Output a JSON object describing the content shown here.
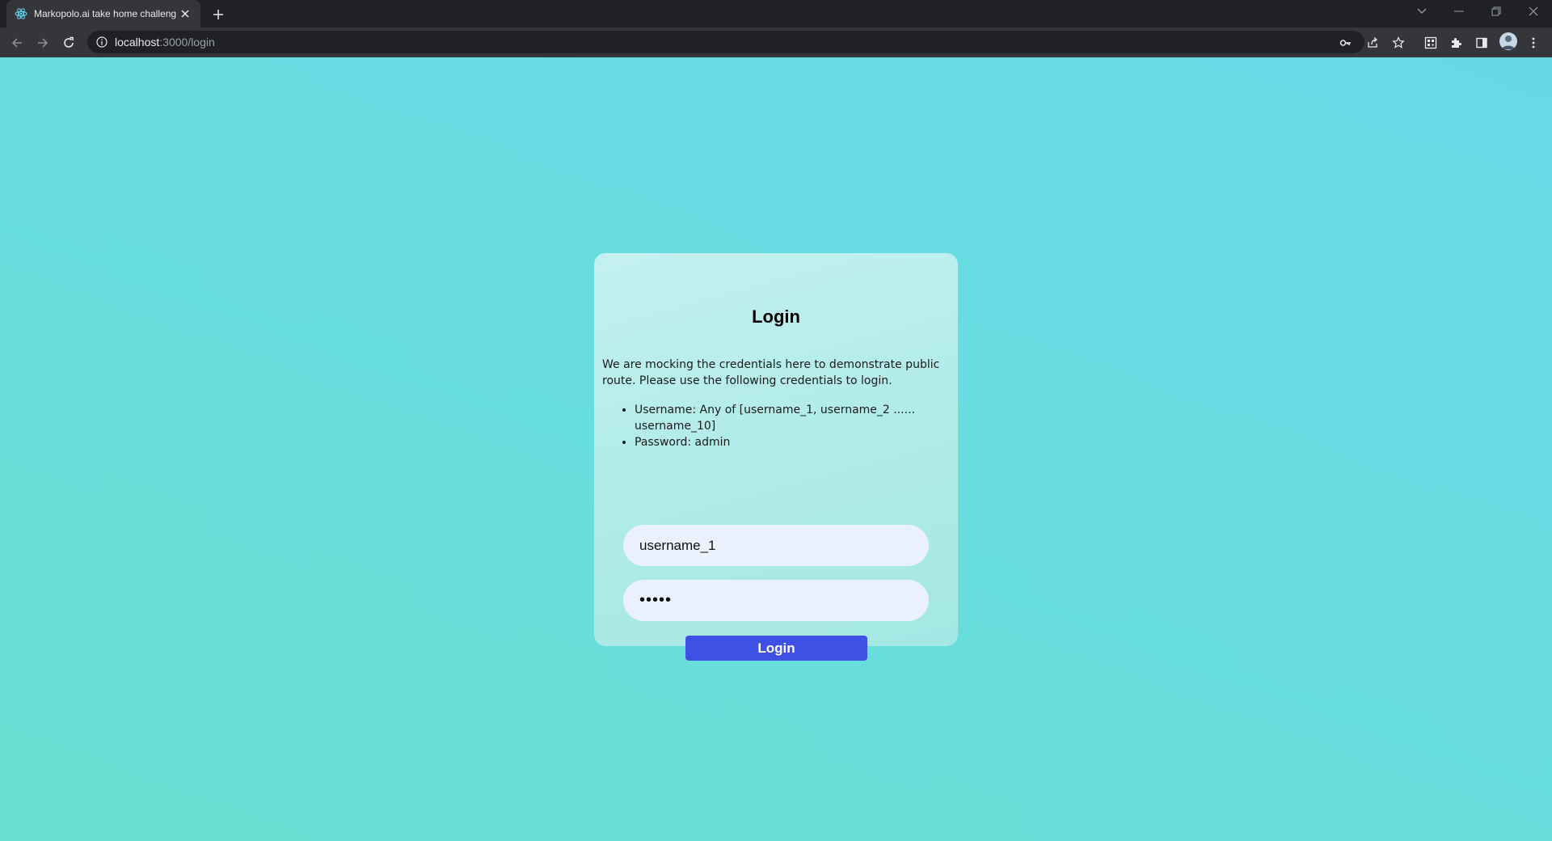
{
  "browser": {
    "tab_title": "Markopolo.ai take home challenge",
    "tab_icon": "react-icon",
    "url_host": "localhost",
    "url_path": ":3000/login",
    "toolbar_icons": [
      "key-icon",
      "share-icon",
      "bookmark-star-icon",
      "qr-code-icon",
      "extensions-icon",
      "side-panel-icon",
      "profile-avatar",
      "more-menu-icon"
    ]
  },
  "login": {
    "title": "Login",
    "description": "We are mocking the credentials here to demonstrate public route. Please use the following credentials to login.",
    "credentials": [
      "Username: Any of [username_1, username_2 ...... username_10]",
      "Password: admin"
    ],
    "username_value": "username_1",
    "password_value": "•••••",
    "button_label": "Login"
  },
  "notification_badge": "0",
  "colors": {
    "accent": "#3f51e5",
    "background": "#67dde0",
    "badge": "#5d1469"
  }
}
